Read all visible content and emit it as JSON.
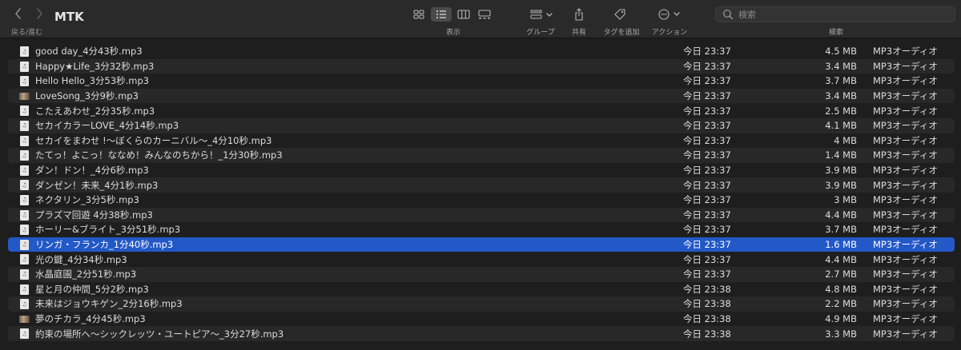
{
  "window": {
    "title": "MTK"
  },
  "toolbar": {
    "nav_label": "戻る/進む",
    "view_label": "表示",
    "group_label": "グループ",
    "share_label": "共有",
    "tag_label": "タグを追加",
    "action_label": "アクション",
    "search_label": "検索",
    "search_placeholder": "検索",
    "icons": [
      "chevron-left-icon",
      "chevron-right-icon",
      "icon-view-icon",
      "list-view-icon",
      "column-view-icon",
      "gallery-view-icon",
      "group-icon",
      "share-icon",
      "tag-icon",
      "action-icon",
      "search-icon"
    ]
  },
  "colors": {
    "selection": "#2358c7",
    "background": "#1e1e1e",
    "row_alt": "#282828",
    "toolbar": "#2a2a2a"
  },
  "files": [
    {
      "name": "good day_4分43秒.mp3",
      "date": "今日 23:37",
      "size": "4.5 MB",
      "kind": "MP3オーディオ",
      "icon": "doc"
    },
    {
      "name": "Happy★Life_3分32秒.mp3",
      "date": "今日 23:37",
      "size": "3.4 MB",
      "kind": "MP3オーディオ",
      "icon": "doc"
    },
    {
      "name": "Hello Hello_3分53秒.mp3",
      "date": "今日 23:37",
      "size": "3.7 MB",
      "kind": "MP3オーディオ",
      "icon": "doc"
    },
    {
      "name": "LoveSong_3分9秒.mp3",
      "date": "今日 23:37",
      "size": "3.4 MB",
      "kind": "MP3オーディオ",
      "icon": "art"
    },
    {
      "name": "こたえあわせ_2分35秒.mp3",
      "date": "今日 23:37",
      "size": "2.5 MB",
      "kind": "MP3オーディオ",
      "icon": "doc"
    },
    {
      "name": "セカイカラーLOVE_4分14秒.mp3",
      "date": "今日 23:37",
      "size": "4.1 MB",
      "kind": "MP3オーディオ",
      "icon": "doc"
    },
    {
      "name": "セカイをまわせ !〜ぼくらのカーニバル〜_4分10秒.mp3",
      "date": "今日 23:37",
      "size": "4 MB",
      "kind": "MP3オーディオ",
      "icon": "doc"
    },
    {
      "name": "たてっ！よこっ！ななめ！みんなのちから！_1分30秒.mp3",
      "date": "今日 23:37",
      "size": "1.4 MB",
      "kind": "MP3オーディオ",
      "icon": "doc"
    },
    {
      "name": "ダン！ドン！_4分6秒.mp3",
      "date": "今日 23:37",
      "size": "3.9 MB",
      "kind": "MP3オーディオ",
      "icon": "doc"
    },
    {
      "name": "ダンゼン！未来_4分1秒.mp3",
      "date": "今日 23:37",
      "size": "3.9 MB",
      "kind": "MP3オーディオ",
      "icon": "doc"
    },
    {
      "name": "ネクタリン_3分5秒.mp3",
      "date": "今日 23:37",
      "size": "3 MB",
      "kind": "MP3オーディオ",
      "icon": "doc"
    },
    {
      "name": "プラズマ回遊 4分38秒.mp3",
      "date": "今日 23:37",
      "size": "4.4 MB",
      "kind": "MP3オーディオ",
      "icon": "doc"
    },
    {
      "name": "ホーリー&ブライト_3分51秒.mp3",
      "date": "今日 23:37",
      "size": "3.7 MB",
      "kind": "MP3オーディオ",
      "icon": "doc"
    },
    {
      "name": "リンガ・フランカ_1分40秒.mp3",
      "date": "今日 23:37",
      "size": "1.6 MB",
      "kind": "MP3オーディオ",
      "icon": "doc",
      "selected": true
    },
    {
      "name": "光の鍵_4分34秒.mp3",
      "date": "今日 23:37",
      "size": "4.4 MB",
      "kind": "MP3オーディオ",
      "icon": "doc"
    },
    {
      "name": "水晶庭園_2分51秒.mp3",
      "date": "今日 23:37",
      "size": "2.7 MB",
      "kind": "MP3オーディオ",
      "icon": "doc"
    },
    {
      "name": "星と月の仲間_5分2秒.mp3",
      "date": "今日 23:38",
      "size": "4.8 MB",
      "kind": "MP3オーディオ",
      "icon": "doc"
    },
    {
      "name": "未来はジョウキゲン_2分16秒.mp3",
      "date": "今日 23:38",
      "size": "2.2 MB",
      "kind": "MP3オーディオ",
      "icon": "doc"
    },
    {
      "name": "夢のチカラ_4分45秒.mp3",
      "date": "今日 23:38",
      "size": "4.9 MB",
      "kind": "MP3オーディオ",
      "icon": "art"
    },
    {
      "name": "約束の場所へ〜シックレッツ・ユートピア〜_3分27秒.mp3",
      "date": "今日 23:38",
      "size": "3.3 MB",
      "kind": "MP3オーディオ",
      "icon": "doc"
    }
  ]
}
